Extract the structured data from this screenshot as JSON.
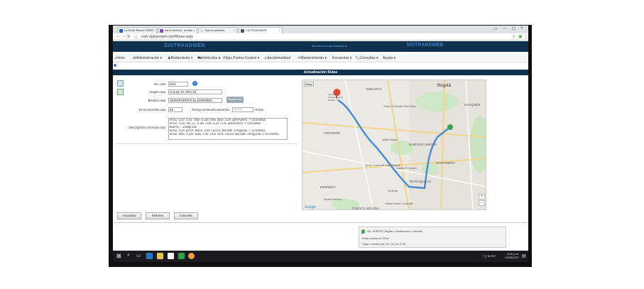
{
  "browser": {
    "tabs": [
      {
        "label": "La Emile Mosca TB/RT"
      },
      {
        "label": "sin no textual - conflic..."
      },
      {
        "label": "Nueva pestaña"
      },
      {
        "label": "SIGTRANSWEB"
      }
    ],
    "url": "sisft.sigtranswef.com/Rutas.aspx"
  },
  "header": {
    "brand_left": "SIGTRANSWEB",
    "welcome": "Bienvenido Sala Wabalsone",
    "brand_right": "SIGTRANSWEB"
  },
  "menu": [
    {
      "label": "Inicio"
    },
    {
      "label": "Administración ▾"
    },
    {
      "label": "Rodamiento ▾"
    },
    {
      "label": "Vehículos ▾"
    },
    {
      "label": "Gps Puntos Control ▾"
    },
    {
      "label": "Accidentalidad"
    },
    {
      "label": "Mantenimiento ▾"
    },
    {
      "label": "Encuestas ▾"
    },
    {
      "label": "Consultas ▾"
    },
    {
      "label": "Ayuda ▾"
    }
  ],
  "page": {
    "title": "Actualización Rutas"
  },
  "form": {
    "no_ruta_label": "No. ruta",
    "no_ruta_value": "SH5",
    "origen_label": "Origen ruta",
    "origen_value": "CALLE 87 CRA 15",
    "destino_label": "Destino ruta",
    "destino_value": "AEROPUERTO EL DORADO",
    "buscar_label": "Buscar ruta",
    "kms_label": "Kms recorrido ruta",
    "kms_value": "28",
    "tiempo_label": "Tiempo estimado recorrido",
    "tiempo_placeholder": "HH:mm",
    "horas_label": "Horas",
    "descripcion_label": "Descripcion recorrido ruta",
    "descripcion_lines": [
      "RUTA1 CL87 CL32 CR30 CL100 CR50 AV68 CL26 AEROPUERTO Y VICEVERSA",
      "RUTA2 CL93 CRA 11 CL100 CR30 CL26 CL26 AEROPUERTO Y VICEVERSA",
      "BOGOTA - ZIPAQUIRA",
      "RUTA1 CL87 AUTOP NORTE CHIA CAJICA BRICEÑO ZIPAQUIRA Y VICEVERSA",
      "RUTA2 CR15 CL100 AV68 CL80 COTA CHIA CAJICA BRICEÑO ZIPAQUIRA Y VICEVERSA"
    ]
  },
  "buttons": {
    "actualizar": "Actualizar",
    "eliminar": "Eliminar",
    "cancelar": "Cancelar"
  },
  "map": {
    "type_button": "Mapa",
    "labels": [
      "ENGATIVÁ",
      "Bogotá",
      "USAQUÉN",
      "FONTIBÓN",
      "BARRIOS UNIDOS",
      "CHAPINERO",
      "KENNEDY",
      "TEUSAQUILLO",
      "PUENTE ARANDA",
      "Aeropuerto Internacional El Dorado",
      "Salitre Mágico",
      "Centro Comercial Titán Plaza",
      "Centro Comercial Gran Estación",
      "Estadio El Campín",
      "Corferias",
      "Calima Centro Comercial",
      "Mundo Aventura",
      "Google"
    ],
    "zoom_in": "+",
    "zoom_out": "−"
  },
  "popup": {
    "title": "Via - PUENTE / Bogota, Cundinamarca, Colombia",
    "line1": "Rutas creadas de 28 km",
    "line2": "Origen a destino por Cra. 15 y Av. El 26"
  },
  "taskbar": {
    "time": "8:29 p.m.",
    "date": "10/06/2017",
    "lang": "ESP"
  },
  "colors": {
    "header": "#10314d",
    "accent": "#3a7fc0",
    "route": "#4a8fd6"
  }
}
